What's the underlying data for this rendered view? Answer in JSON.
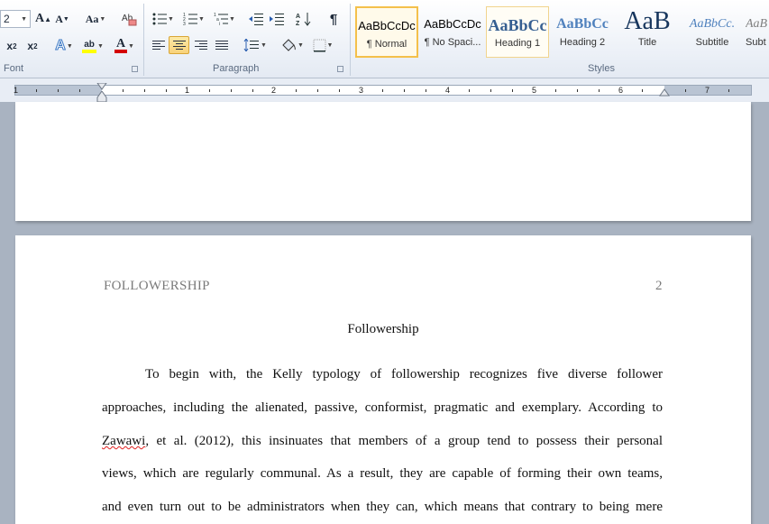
{
  "ribbon": {
    "font_size_value": "2",
    "change_case_label": "Aa",
    "groups": {
      "font": "Font",
      "paragraph": "Paragraph",
      "styles": "Styles"
    },
    "styles": [
      {
        "sample": "AaBbCcDc",
        "name": "¶ Normal"
      },
      {
        "sample": "AaBbCcDc",
        "name": "¶ No Spaci..."
      },
      {
        "sample": "AaBbCc",
        "name": "Heading 1"
      },
      {
        "sample": "AaBbCc",
        "name": "Heading 2"
      },
      {
        "sample": "AaB",
        "name": "Title"
      },
      {
        "sample": "AaBbCc.",
        "name": "Subtitle"
      },
      {
        "sample": "AaB",
        "name": "Subt"
      }
    ],
    "highlight_color": "#ffff00",
    "font_color": "#d40000"
  },
  "ruler": {
    "numbers": [
      "1",
      "1",
      "2",
      "3",
      "4",
      "5",
      "6",
      "7"
    ]
  },
  "document": {
    "header_left": "FOLLOWERSHIP",
    "page_number": "2",
    "title": "Followership",
    "lines": [
      "To begin with, the Kelly typology of followership recognizes five diverse follower",
      "approaches, including the alienated, passive, conformist, pragmatic and exemplary. According to",
      ", et al. (2012), this insinuates that members of a group tend to possess their personal",
      "views, which are regularly communal. As a result, they are capable of forming their own teams,",
      "and even turn out to be administrators when they can, which means that contrary to being mere"
    ],
    "misspelled_word": "Zawawi"
  }
}
